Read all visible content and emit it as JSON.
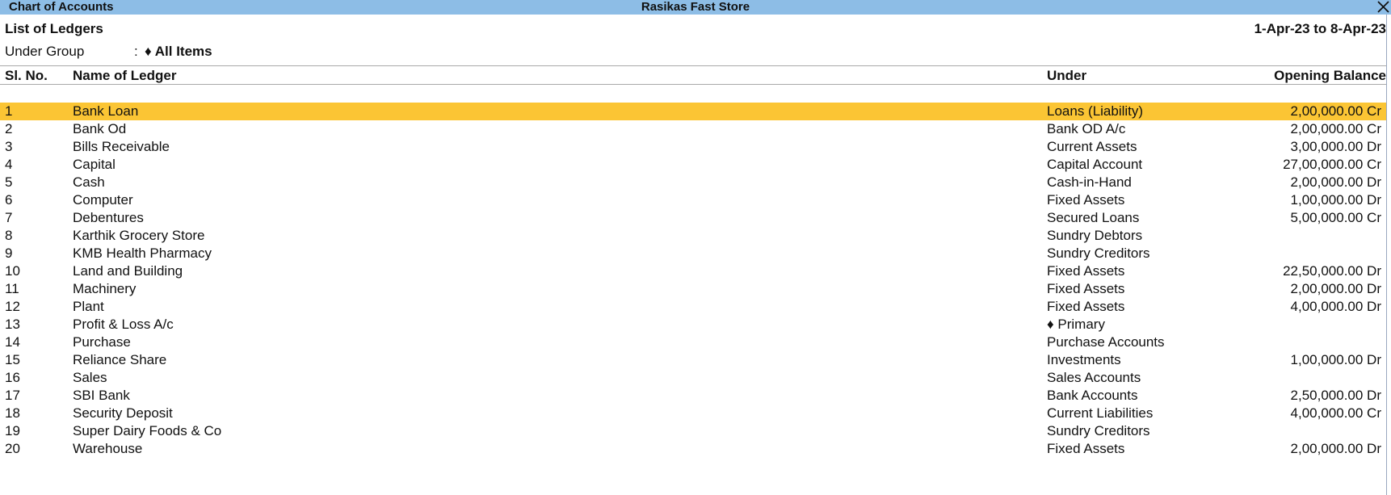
{
  "window": {
    "screen_title": "Chart of Accounts",
    "company_name": "Rasikas Fast Store",
    "close_icon": "close-icon"
  },
  "report": {
    "title": "List of Ledgers",
    "period": "1-Apr-23 to 8-Apr-23",
    "group_label": "Under Group",
    "group_separator": ":",
    "group_value": "♦ All Items"
  },
  "columns": {
    "sl_no": "Sl. No.",
    "name": "Name of Ledger",
    "under": "Under",
    "balance": "Opening Balance"
  },
  "colors": {
    "titlebar": "#8dbde6",
    "selected_row": "#fbc534"
  },
  "selected_index": 0,
  "ledgers": [
    {
      "sl": "1",
      "name": "Bank Loan",
      "under": "Loans (Liability)",
      "balance": "2,00,000.00 Cr"
    },
    {
      "sl": "2",
      "name": "Bank Od",
      "under": "Bank OD A/c",
      "balance": "2,00,000.00 Cr"
    },
    {
      "sl": "3",
      "name": "Bills Receivable",
      "under": "Current Assets",
      "balance": "3,00,000.00 Dr"
    },
    {
      "sl": "4",
      "name": "Capital",
      "under": "Capital Account",
      "balance": "27,00,000.00 Cr"
    },
    {
      "sl": "5",
      "name": "Cash",
      "under": "Cash-in-Hand",
      "balance": "2,00,000.00 Dr"
    },
    {
      "sl": "6",
      "name": "Computer",
      "under": "Fixed Assets",
      "balance": "1,00,000.00 Dr"
    },
    {
      "sl": "7",
      "name": "Debentures",
      "under": "Secured Loans",
      "balance": "5,00,000.00 Cr"
    },
    {
      "sl": "8",
      "name": "Karthik Grocery Store",
      "under": "Sundry Debtors",
      "balance": ""
    },
    {
      "sl": "9",
      "name": "KMB Health Pharmacy",
      "under": "Sundry Creditors",
      "balance": ""
    },
    {
      "sl": "10",
      "name": "Land and Building",
      "under": "Fixed Assets",
      "balance": "22,50,000.00 Dr"
    },
    {
      "sl": "11",
      "name": "Machinery",
      "under": "Fixed Assets",
      "balance": "2,00,000.00 Dr"
    },
    {
      "sl": "12",
      "name": "Plant",
      "under": "Fixed Assets",
      "balance": "4,00,000.00 Dr"
    },
    {
      "sl": "13",
      "name": "Profit & Loss A/c",
      "under": "♦ Primary",
      "balance": ""
    },
    {
      "sl": "14",
      "name": "Purchase",
      "under": "Purchase Accounts",
      "balance": ""
    },
    {
      "sl": "15",
      "name": "Reliance Share",
      "under": "Investments",
      "balance": "1,00,000.00 Dr"
    },
    {
      "sl": "16",
      "name": "Sales",
      "under": "Sales Accounts",
      "balance": ""
    },
    {
      "sl": "17",
      "name": "SBI Bank",
      "under": "Bank Accounts",
      "balance": "2,50,000.00 Dr"
    },
    {
      "sl": "18",
      "name": "Security Deposit",
      "under": "Current Liabilities",
      "balance": "4,00,000.00 Cr"
    },
    {
      "sl": "19",
      "name": "Super Dairy Foods & Co",
      "under": "Sundry Creditors",
      "balance": ""
    },
    {
      "sl": "20",
      "name": "Warehouse",
      "under": "Fixed Assets",
      "balance": "2,00,000.00 Dr"
    }
  ]
}
